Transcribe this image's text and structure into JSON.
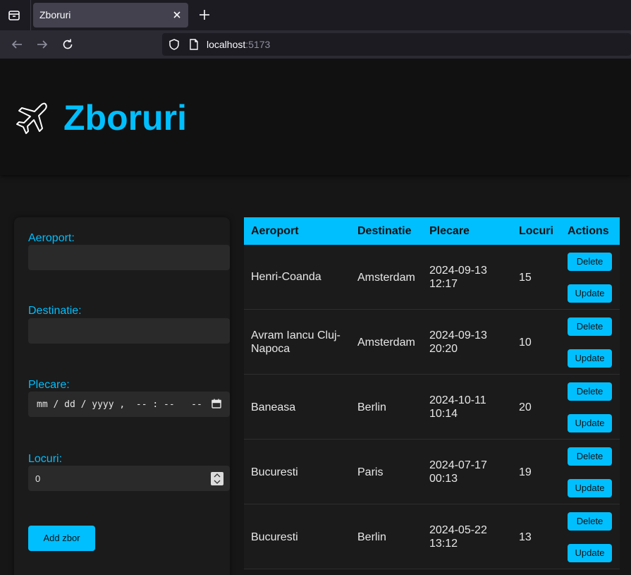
{
  "browser": {
    "tab_title": "Zboruri",
    "url_host": "localhost",
    "url_port": ":5173"
  },
  "header": {
    "title": "Zboruri"
  },
  "form": {
    "aeroport_label": "Aeroport:",
    "aeroport_value": "",
    "destinatie_label": "Destinatie:",
    "destinatie_value": "",
    "plecare_label": "Plecare:",
    "plecare_placeholder": "mm / dd / yyyy ,  -- : --   --",
    "locuri_label": "Locuri:",
    "locuri_value": "0",
    "submit_label": "Add zbor"
  },
  "table": {
    "columns": [
      "Aeroport",
      "Destinatie",
      "Plecare",
      "Locuri",
      "Actions"
    ],
    "delete_label": "Delete",
    "update_label": "Update",
    "rows": [
      {
        "aeroport": "Henri-Coanda",
        "destinatie": "Amsterdam",
        "plecare_date": "2024-09-13",
        "plecare_time": "12:17",
        "locuri": "15"
      },
      {
        "aeroport": "Avram Iancu Cluj-Napoca",
        "destinatie": "Amsterdam",
        "plecare_date": "2024-09-13",
        "plecare_time": "20:20",
        "locuri": "10"
      },
      {
        "aeroport": "Baneasa",
        "destinatie": "Berlin",
        "plecare_date": "2024-10-11",
        "plecare_time": "10:14",
        "locuri": "20"
      },
      {
        "aeroport": "Bucuresti",
        "destinatie": "Paris",
        "plecare_date": "2024-07-17",
        "plecare_time": "00:13",
        "locuri": "19"
      },
      {
        "aeroport": "Bucuresti",
        "destinatie": "Berlin",
        "plecare_date": "2024-05-22",
        "plecare_time": "13:12",
        "locuri": "13"
      }
    ]
  },
  "colors": {
    "accent": "#00bfff",
    "background": "#161616",
    "header_bg": "#111111"
  }
}
